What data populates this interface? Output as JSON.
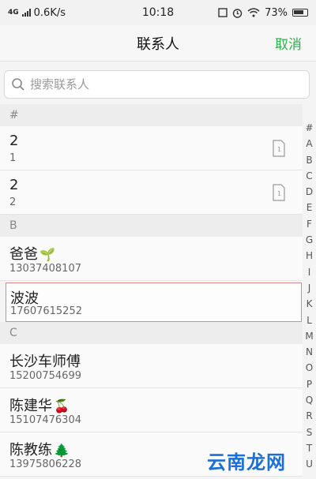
{
  "status": {
    "network": "4G",
    "speed": "0.6K/s",
    "time": "10:18",
    "battery": "73%"
  },
  "header": {
    "title": "联系人",
    "cancel": "取消"
  },
  "search": {
    "placeholder": "搜索联系人"
  },
  "sections": [
    {
      "letter": "#",
      "contacts": [
        {
          "name": "2",
          "phone": "1",
          "sim": true
        },
        {
          "name": "2",
          "phone": "2",
          "sim": true
        }
      ]
    },
    {
      "letter": "B",
      "contacts": [
        {
          "name": "爸爸",
          "emoji": "🌱",
          "phone": "13037408107"
        },
        {
          "name": "波波",
          "phone": "17607615252",
          "selected": true
        }
      ]
    },
    {
      "letter": "C",
      "contacts": [
        {
          "name": "长沙车师傅",
          "phone": "15200754699"
        },
        {
          "name": "陈建华",
          "emoji": "🍒",
          "phone": "15107476304"
        },
        {
          "name": "陈教练",
          "emoji": "🌲",
          "phone": "13975806228"
        }
      ]
    }
  ],
  "index_letters": [
    "#",
    "A",
    "B",
    "C",
    "D",
    "E",
    "F",
    "G",
    "H",
    "I",
    "J",
    "K",
    "L",
    "M",
    "N",
    "O",
    "P",
    "Q",
    "R",
    "S",
    "T",
    "U"
  ],
  "watermark": "云南龙网"
}
